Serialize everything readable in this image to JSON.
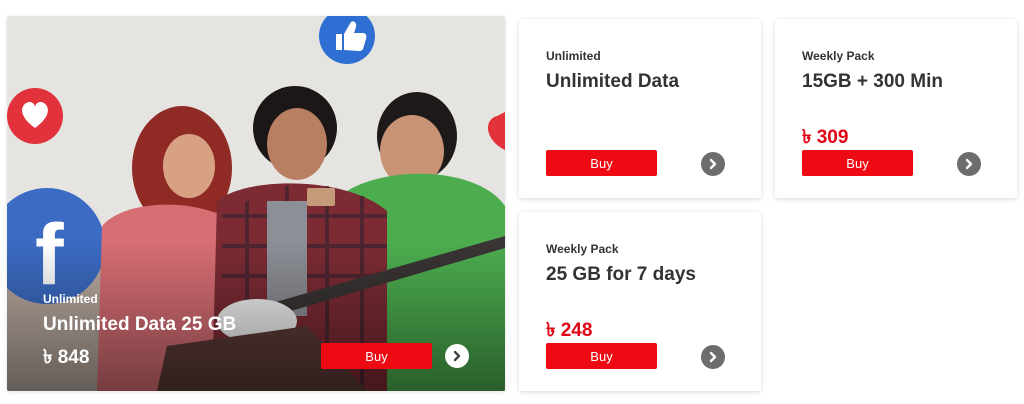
{
  "colors": {
    "accent": "#ee0a12",
    "price": "#e10613",
    "arrow_bg": "#6d6d6d"
  },
  "hero": {
    "image": "promo-image-friends-with-phone-and-guitar",
    "category": "Unlimited",
    "title": "Unlimited Data 25 GB",
    "price": "৳ 848",
    "buy_label": "Buy",
    "arrow_icon": "chevron-right-icon"
  },
  "cards": [
    {
      "category": "Unlimited",
      "title": "Unlimited Data",
      "price": "",
      "buy_label": "Buy",
      "arrow_icon": "chevron-right-icon"
    },
    {
      "category": "Weekly Pack",
      "title": "15GB + 300 Min",
      "price": "৳ 309",
      "buy_label": "Buy",
      "arrow_icon": "chevron-right-icon"
    },
    {
      "category": "Weekly Pack",
      "title": "25 GB for 7 days",
      "price": "৳ 248",
      "buy_label": "Buy",
      "arrow_icon": "chevron-right-icon"
    }
  ]
}
